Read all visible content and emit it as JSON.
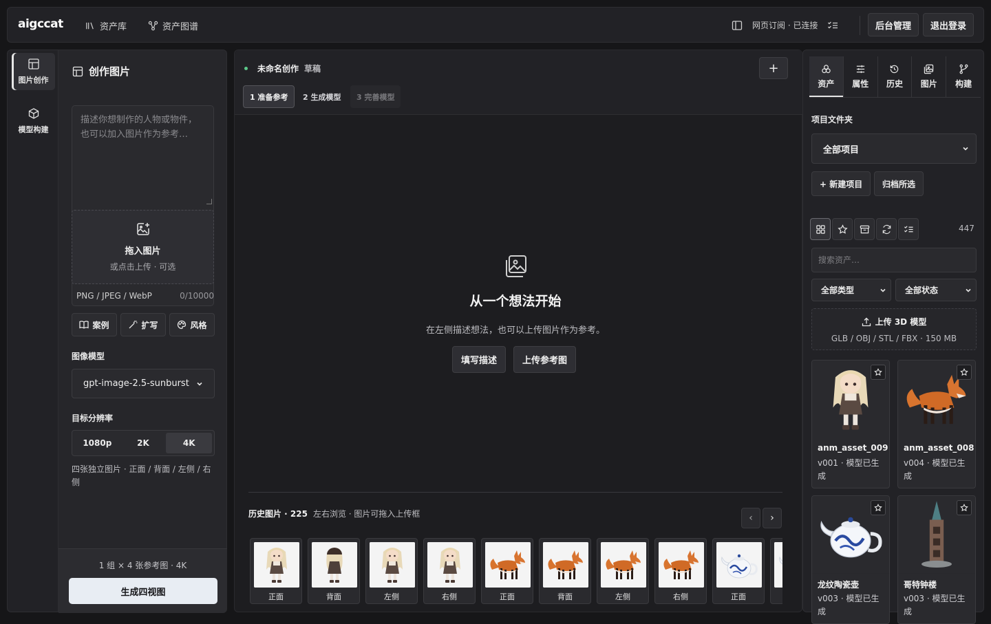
{
  "topbar": {
    "logo": "aigccat",
    "nav": [
      {
        "label": "资产库",
        "icon": "library-icon"
      },
      {
        "label": "资产图谱",
        "icon": "graph-icon"
      }
    ],
    "subscription_status": "网页订阅 · 已连接",
    "admin_label": "后台管理",
    "logout_label": "退出登录"
  },
  "rail": {
    "items": [
      {
        "label": "图片创作",
        "icon": "image-layout-icon",
        "active": true
      },
      {
        "label": "模型构建",
        "icon": "cube-icon",
        "active": false
      }
    ]
  },
  "left": {
    "title": "创作图片",
    "prompt_placeholder": "描述你想制作的人物或物件，也可以加入图片作为参考…",
    "drop_title": "拖入图片",
    "drop_sub": "或点击上传 · 可选",
    "formats": "PNG / JPEG / WebP",
    "char_count": "0/10000",
    "chips": [
      {
        "label": "案例",
        "icon": "book-icon"
      },
      {
        "label": "扩写",
        "icon": "magic-wand-icon"
      },
      {
        "label": "风格",
        "icon": "palette-icon"
      }
    ],
    "model_label": "图像模型",
    "model_value": "gpt-image-2.5-sunburst",
    "resolution_label": "目标分辨率",
    "resolutions": [
      "1080p",
      "2K",
      "4K"
    ],
    "resolution_selected": "4K",
    "resolution_note": "四张独立图片 · 正面 / 背面 / 左侧 / 右侧",
    "footer_info": "1 组 × 4 张参考图 · 4K",
    "generate_label": "生成四视图"
  },
  "center": {
    "title": "未命名创作",
    "status": "草稿",
    "steps": [
      "1 准备参考",
      "2 生成模型",
      "3 完善模型"
    ],
    "empty_title": "从一个想法开始",
    "empty_sub": "在左侧描述想法，也可以上传图片作为参考。",
    "btn_fill": "填写描述",
    "btn_upload": "上传参考图",
    "history_title": "历史图片 · 225",
    "history_sub": "左右浏览 · 图片可拖入上传框",
    "history": [
      {
        "label": "正面",
        "subject": "girl"
      },
      {
        "label": "背面",
        "subject": "girl-back"
      },
      {
        "label": "左侧",
        "subject": "girl"
      },
      {
        "label": "右侧",
        "subject": "girl"
      },
      {
        "label": "正面",
        "subject": "fox"
      },
      {
        "label": "背面",
        "subject": "fox"
      },
      {
        "label": "左侧",
        "subject": "fox"
      },
      {
        "label": "右侧",
        "subject": "fox"
      },
      {
        "label": "正面",
        "subject": "teapot"
      },
      {
        "label": "",
        "subject": "teapot"
      }
    ]
  },
  "right": {
    "tabs": [
      {
        "label": "资产",
        "icon": "assets-icon",
        "active": true
      },
      {
        "label": "属性",
        "icon": "sliders-icon",
        "active": false
      },
      {
        "label": "历史",
        "icon": "history-icon",
        "active": false
      },
      {
        "label": "图片",
        "icon": "images-icon",
        "active": false
      },
      {
        "label": "构建",
        "icon": "build-icon",
        "active": false
      }
    ],
    "folder_label": "项目文件夹",
    "folder_value": "全部项目",
    "new_project": "+ 新建项目",
    "archive": "归档所选",
    "asset_count": "447",
    "search_placeholder": "搜索资产…",
    "type_filter": "全部类型",
    "status_filter": "全部状态",
    "upload_title": "上传 3D 模型",
    "upload_formats": "GLB / OBJ / STL / FBX · 150 MB",
    "assets": [
      {
        "name": "anm_asset_009",
        "status": "v001 · 模型已生成",
        "subject": "girl"
      },
      {
        "name": "anm_asset_008",
        "status": "v004 · 模型已生成",
        "subject": "fox"
      },
      {
        "name": "龙纹陶瓷壶",
        "status": "v003 · 模型已生成",
        "subject": "teapot"
      },
      {
        "name": "哥特钟楼",
        "status": "v003 · 模型已生成",
        "subject": "tower"
      }
    ]
  }
}
